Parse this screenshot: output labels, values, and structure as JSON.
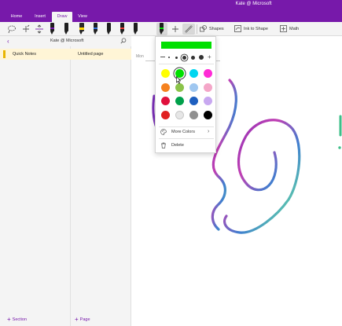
{
  "window": {
    "title": "Kate @ Microsoft"
  },
  "tabs": [
    {
      "label": "Home"
    },
    {
      "label": "Insert"
    },
    {
      "label": "Draw",
      "active": true
    },
    {
      "label": "View"
    }
  ],
  "ribbon": {
    "tool_icons": [
      "lasso-select-icon",
      "add-space-icon",
      "eraser-icon"
    ],
    "pens": [
      {
        "name": "pen",
        "band_color": "#7719aa"
      },
      {
        "name": "pen",
        "band_color": "#1e1e1e"
      },
      {
        "name": "highlighter",
        "band_color": "#ffd700"
      },
      {
        "name": "pen",
        "band_color": "#2f6fd6"
      },
      {
        "name": "pen",
        "band_color": "#1e1e1e"
      },
      {
        "name": "pen",
        "band_color": "#e53935"
      },
      {
        "name": "pen",
        "band_color": "#1e1e1e"
      },
      {
        "name": "pen-selected",
        "band_color": "#00d200"
      }
    ],
    "add_pen_icon": "plus-icon",
    "ruler_icon": "ruler-icon",
    "shapes_label": "Shapes",
    "ink_to_shape_label": "Ink to Shape",
    "math_label": "Math"
  },
  "navigation": {
    "notebook_name": "Kate @ Microsoft",
    "back_icon": "chevron-left-icon",
    "search_icon": "search-icon",
    "sections": [
      {
        "label": "Quick Notes",
        "color": "#e8b500"
      }
    ],
    "pages": [
      {
        "label": "Untitled page"
      }
    ],
    "add_section_label": "Section",
    "add_page_label": "Page"
  },
  "canvas": {
    "date_fragment": "Mon"
  },
  "pen_popup": {
    "preview_color": "#00e000",
    "thickness_count": 5,
    "selected_thickness_index": 2,
    "colors": [
      "#ffff00",
      "#00e000",
      "#00d6f0",
      "#ff2bd6",
      "#f5821f",
      "#8bc34a",
      "#9fc7f0",
      "#f4a6c8",
      "#e0103c",
      "#00a04a",
      "#1e5fbf",
      "#c8a8f0",
      "#e02020",
      "#e6e6e6",
      "#909090",
      "#000000"
    ],
    "selected_color_index": 1,
    "more_colors_label": "More Colors",
    "delete_label": "Delete"
  },
  "accent_color": "#7719aa"
}
